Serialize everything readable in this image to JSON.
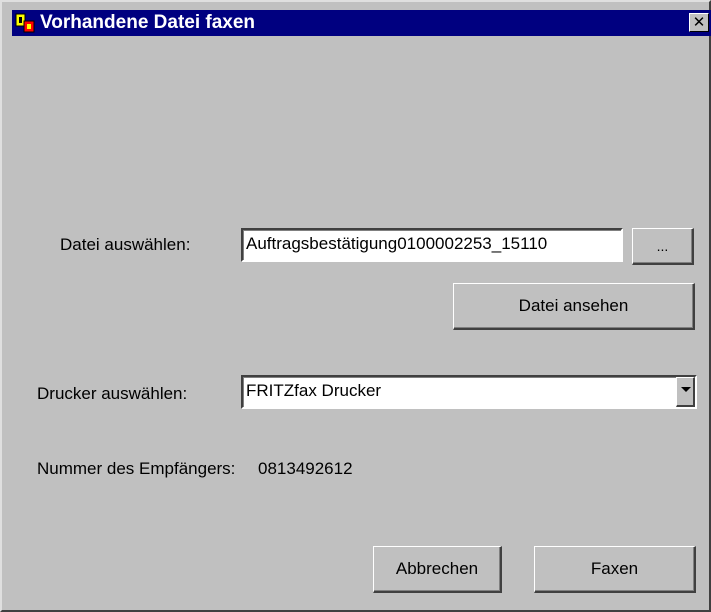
{
  "window": {
    "title": "Vorhandene Datei faxen",
    "close_label": "✕"
  },
  "file": {
    "label": "Datei auswählen:",
    "value": "Auftragsbestätigung0100002253_15110",
    "browse_label": "...",
    "view_label": "Datei ansehen"
  },
  "printer": {
    "label": "Drucker auswählen:",
    "selected": "FRITZfax Drucker"
  },
  "recipient": {
    "label": "Nummer des Empfängers:",
    "number": "0813492612"
  },
  "actions": {
    "cancel_label": "Abbrechen",
    "fax_label": "Faxen"
  },
  "colors": {
    "titlebar": "#000080",
    "face": "#c0c0c0",
    "icon_yellow": "#ffff00",
    "icon_red": "#ff0000"
  }
}
